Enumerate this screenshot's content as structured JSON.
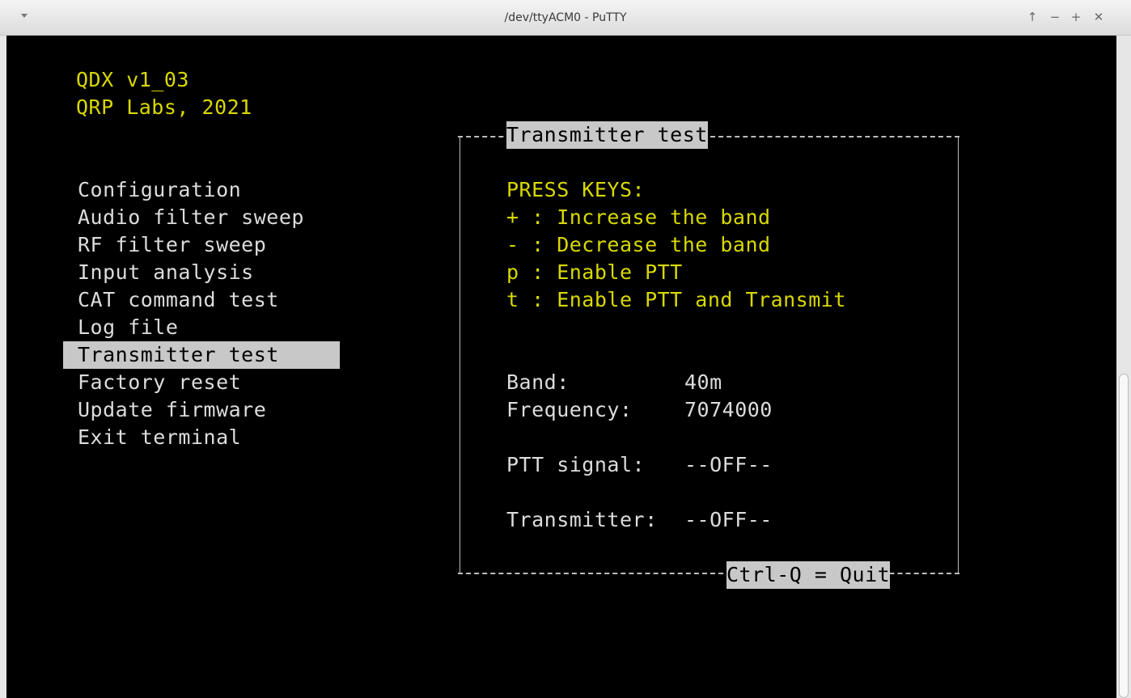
{
  "window": {
    "title": "/dev/ttyACM0 - PuTTY",
    "buttons": {
      "up": "↑",
      "minimize": "−",
      "maximize": "+",
      "close": "✕"
    }
  },
  "header": {
    "line1": "QDX v1_03",
    "line2": "QRP Labs, 2021"
  },
  "menu": {
    "items": [
      "Configuration",
      "Audio filter sweep",
      "RF filter sweep",
      "Input analysis",
      "CAT command test",
      "Log file",
      "Transmitter test",
      "Factory reset",
      "Update firmware",
      "Exit terminal"
    ],
    "selected": "Transmitter test"
  },
  "panel": {
    "title": "Transmitter test",
    "keys_heading": "PRESS KEYS:",
    "keys": [
      "+ : Increase the band",
      "- : Decrease the band",
      "p : Enable PTT",
      "t : Enable PTT and Transmit"
    ],
    "band_label": "Band:",
    "band_value": "40m",
    "frequency_label": "Frequency:",
    "frequency_value": "7074000",
    "ptt_label": "PTT signal:",
    "ptt_value": "--OFF--",
    "tx_label": "Transmitter:",
    "tx_value": "--OFF--",
    "quit_hint": "Ctrl-Q = Quit"
  },
  "colors": {
    "terminal_bg": "#000000",
    "yellow_text": "#d8d800",
    "white_text": "#dcdcdc",
    "highlight_bg": "#c8c8c8"
  }
}
